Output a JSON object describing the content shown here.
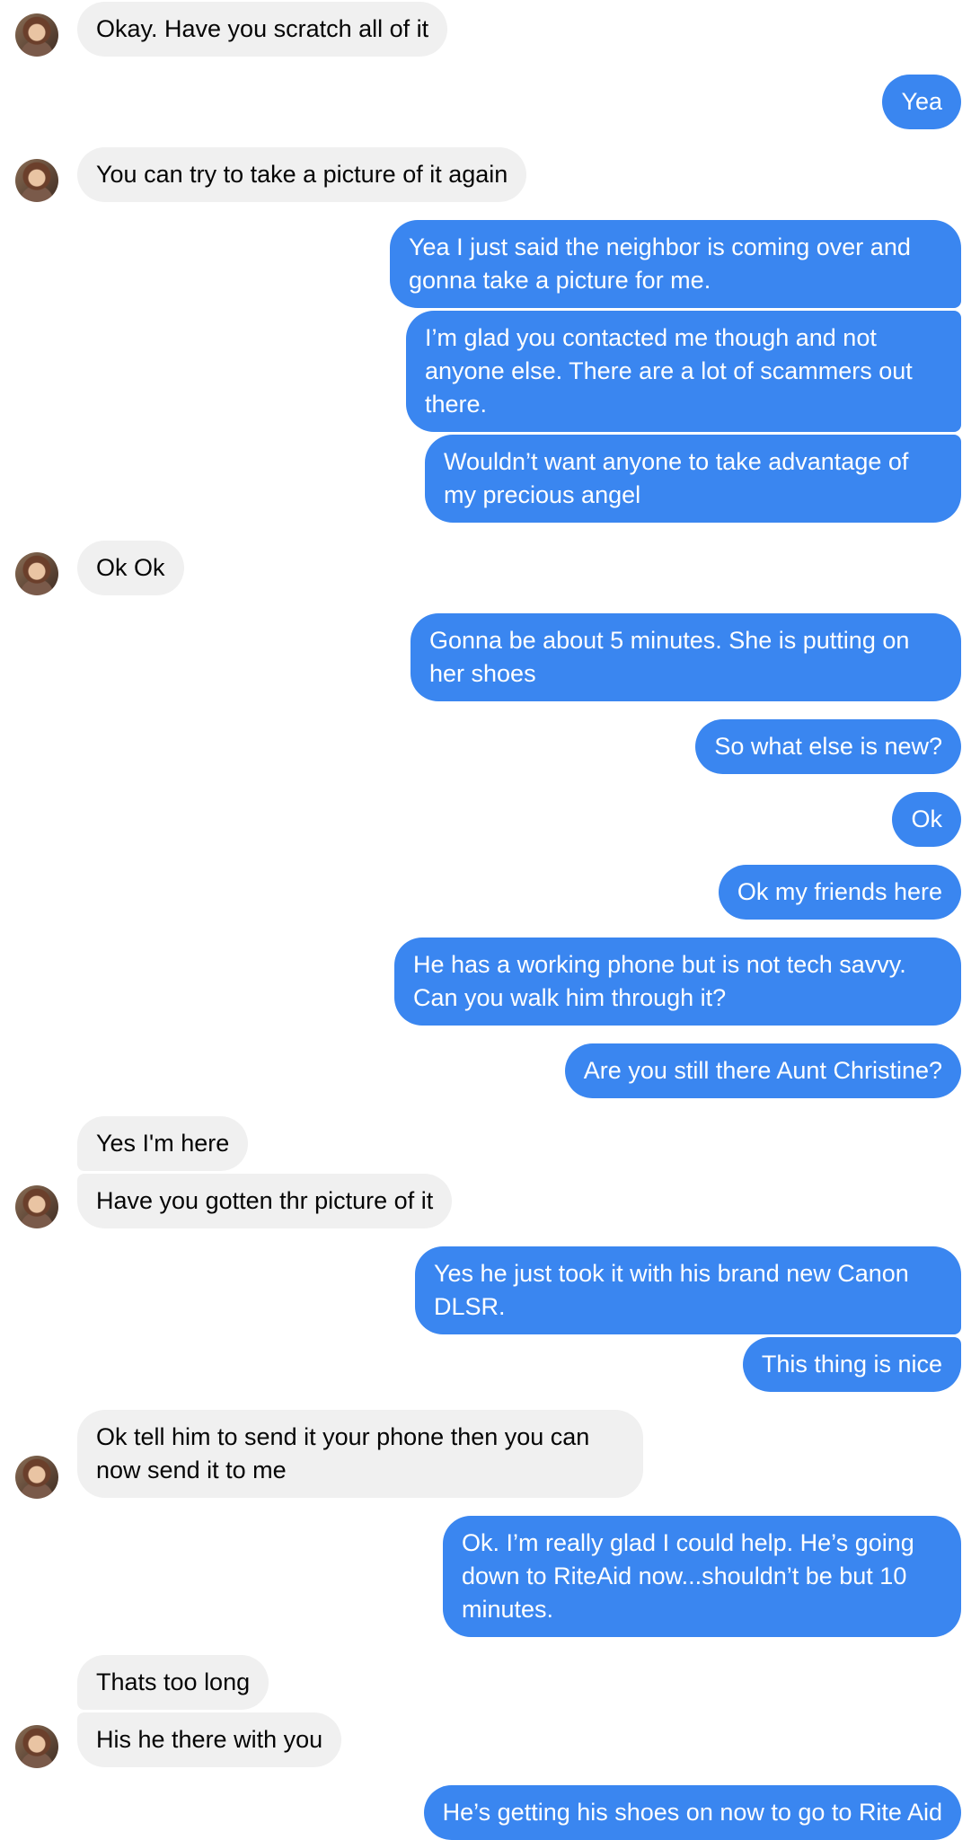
{
  "conversation": {
    "messages": [
      {
        "sender": "them",
        "text": "Okay. Have you scratch all of it"
      },
      {
        "sender": "me",
        "text": "Yea"
      },
      {
        "sender": "them",
        "text": "You can try to take a picture of it again"
      },
      {
        "sender": "me",
        "text": "Yea I just said the neighbor is coming over and gonna take a picture for me."
      },
      {
        "sender": "me",
        "text": "I’m glad you contacted me though and not anyone else. There are a lot of scammers out there."
      },
      {
        "sender": "me",
        "text": "Wouldn’t want anyone to take advantage of my precious angel"
      },
      {
        "sender": "them",
        "text": "Ok Ok"
      },
      {
        "sender": "me",
        "text": "Gonna be about 5 minutes. She is putting on her shoes"
      },
      {
        "sender": "me",
        "text": "So what else is new?"
      },
      {
        "sender": "me",
        "text": "Ok"
      },
      {
        "sender": "me",
        "text": "Ok my friends here"
      },
      {
        "sender": "me",
        "text": "He has a working phone but is not tech savvy. Can you walk him through it?"
      },
      {
        "sender": "me",
        "text": "Are you still there Aunt Christine?"
      },
      {
        "sender": "them",
        "text": "Yes I'm here"
      },
      {
        "sender": "them",
        "text": "Have you gotten thr picture of it"
      },
      {
        "sender": "me",
        "text": "Yes he just took it with his brand new Canon DLSR."
      },
      {
        "sender": "me",
        "text": "This thing is nice"
      },
      {
        "sender": "them",
        "text": "Ok tell him to send it your phone then you can now send it to me"
      },
      {
        "sender": "me",
        "text": "Ok. I’m really glad I could help. He’s going down to RiteAid now...shouldn’t be but 10 minutes."
      },
      {
        "sender": "them",
        "text": "Thats too long"
      },
      {
        "sender": "them",
        "text": "His he there with you"
      },
      {
        "sender": "me",
        "text": "He’s getting his shoes on now to go to Rite Aid"
      }
    ]
  },
  "colors": {
    "outgoing_bubble": "#3a86f0",
    "incoming_bubble": "#f0f0f0"
  },
  "icons": {
    "contact_avatar": "contact-avatar-photo"
  }
}
